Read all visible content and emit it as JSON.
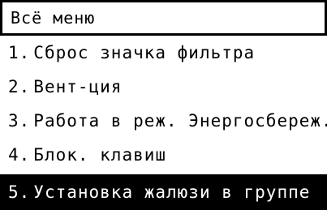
{
  "header": {
    "title": "Всё меню"
  },
  "menu": {
    "items": [
      {
        "number": "1.",
        "label": "Сброс значка фильтра"
      },
      {
        "number": "2.",
        "label": "Вент-ция"
      },
      {
        "number": "3.",
        "label": "Работа в реж. Энергосбереж."
      },
      {
        "number": "4.",
        "label": "Блок. клавиш"
      },
      {
        "number": "5.",
        "label": "Установка жалюзи в группе"
      }
    ],
    "selected_index": 5
  },
  "colors": {
    "background": "#ffffff",
    "text": "#000000",
    "highlight_bg": "#000000",
    "highlight_text": "#ffffff"
  }
}
